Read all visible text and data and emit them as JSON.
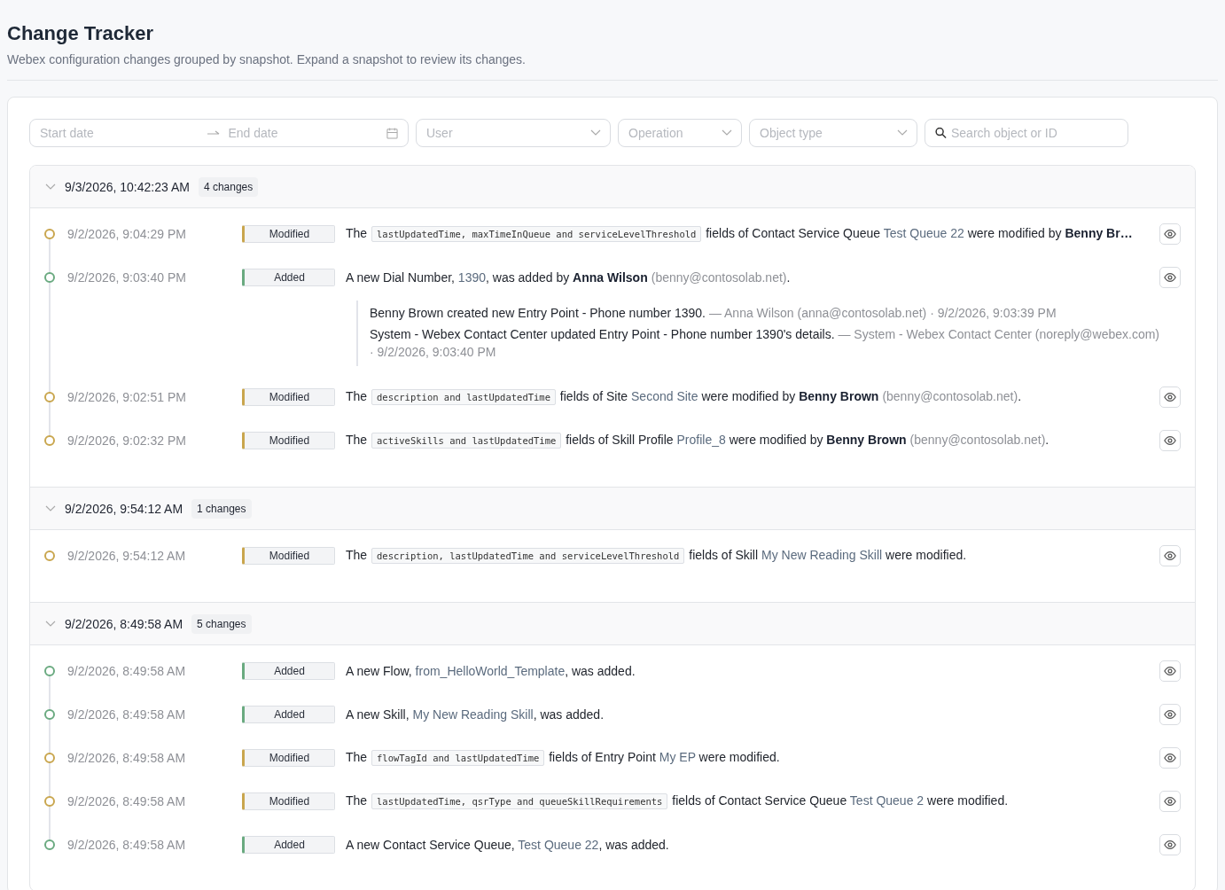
{
  "header": {
    "title": "Change Tracker",
    "subtitle": "Webex configuration changes grouped by snapshot. Expand a snapshot to review its changes."
  },
  "filters": {
    "start_date": {
      "placeholder": "Start date"
    },
    "end_date": {
      "placeholder": "End date"
    },
    "selects": [
      {
        "placeholder": "User"
      },
      {
        "placeholder": "Operation"
      },
      {
        "placeholder": "Object type"
      }
    ],
    "search": {
      "placeholder": "Search object or ID"
    }
  },
  "snapshots": [
    {
      "time": "9/3/2026, 10:42:23 AM",
      "count": "4 changes",
      "expanded": true,
      "changes": [
        {
          "time": "9/2/2026, 9:04:29 PM",
          "kind": "modified",
          "operation": "Modified",
          "description": [
            {
              "kind": "text",
              "text": "The "
            },
            {
              "kind": "code",
              "text": "lastUpdatedTime, maxTimeInQueue and serviceLevelThreshold"
            },
            {
              "kind": "text",
              "text": " fields of Contact Service Queue "
            },
            {
              "kind": "name",
              "text": "Test Queue 22"
            },
            {
              "kind": "text",
              "text": " were modified by "
            },
            {
              "kind": "user",
              "text": "Benny Br…"
            }
          ]
        },
        {
          "time": "9/2/2026, 9:03:40 PM",
          "kind": "added",
          "operation": "Added",
          "description": [
            {
              "kind": "text",
              "text": "A new Dial Number, "
            },
            {
              "kind": "name",
              "text": "1390"
            },
            {
              "kind": "text",
              "text": ", was added by "
            },
            {
              "kind": "user",
              "text": "Anna Wilson"
            },
            {
              "kind": "email",
              "text": "(benny@contosolab.net)"
            },
            {
              "kind": "text",
              "text": "."
            }
          ],
          "notes": [
            {
              "text": "Benny Brown created new Entry Point - Phone number 1390.",
              "source": "— Anna Wilson (anna@contosolab.net) · 9/2/2026, 9:03:39 PM"
            },
            {
              "text": "System - Webex Contact Center updated Entry Point - Phone number 1390's details.",
              "source": "— System - Webex Contact Center (noreply@webex.com) · 9/2/2026, 9:03:40 PM"
            }
          ]
        },
        {
          "time": "9/2/2026, 9:02:51 PM",
          "kind": "modified",
          "operation": "Modified",
          "description": [
            {
              "kind": "text",
              "text": "The "
            },
            {
              "kind": "code",
              "text": "description and lastUpdatedTime"
            },
            {
              "kind": "text",
              "text": " fields of Site "
            },
            {
              "kind": "name",
              "text": "Second Site"
            },
            {
              "kind": "text",
              "text": " were modified by "
            },
            {
              "kind": "user",
              "text": "Benny Brown"
            },
            {
              "kind": "email",
              "text": "(benny@contosolab.net)"
            },
            {
              "kind": "text",
              "text": "."
            }
          ]
        },
        {
          "time": "9/2/2026, 9:02:32 PM",
          "kind": "modified",
          "operation": "Modified",
          "description": [
            {
              "kind": "text",
              "text": "The "
            },
            {
              "kind": "code",
              "text": "activeSkills and lastUpdatedTime"
            },
            {
              "kind": "text",
              "text": " fields of Skill Profile "
            },
            {
              "kind": "name",
              "text": "Profile_8"
            },
            {
              "kind": "text",
              "text": " were modified by "
            },
            {
              "kind": "user",
              "text": "Benny Brown"
            },
            {
              "kind": "email",
              "text": "(benny@contosolab.net)"
            },
            {
              "kind": "text",
              "text": "."
            }
          ]
        }
      ]
    },
    {
      "time": "9/2/2026, 9:54:12 AM",
      "count": "1 changes",
      "expanded": true,
      "changes": [
        {
          "time": "9/2/2026, 9:54:12 AM",
          "kind": "modified",
          "operation": "Modified",
          "description": [
            {
              "kind": "text",
              "text": "The "
            },
            {
              "kind": "code",
              "text": "description, lastUpdatedTime and serviceLevelThreshold"
            },
            {
              "kind": "text",
              "text": " fields of Skill "
            },
            {
              "kind": "name",
              "text": "My New Reading Skill"
            },
            {
              "kind": "text",
              "text": " were modified."
            }
          ]
        }
      ]
    },
    {
      "time": "9/2/2026, 8:49:58 AM",
      "count": "5 changes",
      "expanded": true,
      "changes": [
        {
          "time": "9/2/2026, 8:49:58 AM",
          "kind": "added",
          "operation": "Added",
          "description": [
            {
              "kind": "text",
              "text": "A new Flow, "
            },
            {
              "kind": "name",
              "text": "from_HelloWorld_Template"
            },
            {
              "kind": "text",
              "text": ", was added."
            }
          ]
        },
        {
          "time": "9/2/2026, 8:49:58 AM",
          "kind": "added",
          "operation": "Added",
          "description": [
            {
              "kind": "text",
              "text": "A new Skill, "
            },
            {
              "kind": "name",
              "text": "My New Reading Skill"
            },
            {
              "kind": "text",
              "text": ", was added."
            }
          ]
        },
        {
          "time": "9/2/2026, 8:49:58 AM",
          "kind": "modified",
          "operation": "Modified",
          "description": [
            {
              "kind": "text",
              "text": "The "
            },
            {
              "kind": "code",
              "text": "flowTagId and lastUpdatedTime"
            },
            {
              "kind": "text",
              "text": " fields of Entry Point "
            },
            {
              "kind": "name",
              "text": "My EP"
            },
            {
              "kind": "text",
              "text": " were modified."
            }
          ]
        },
        {
          "time": "9/2/2026, 8:49:58 AM",
          "kind": "modified",
          "operation": "Modified",
          "description": [
            {
              "kind": "text",
              "text": "The "
            },
            {
              "kind": "code",
              "text": "lastUpdatedTime, qsrType and queueSkillRequirements"
            },
            {
              "kind": "text",
              "text": " fields of Contact Service Queue "
            },
            {
              "kind": "name",
              "text": "Test Queue 2"
            },
            {
              "kind": "text",
              "text": " were modified."
            }
          ]
        },
        {
          "time": "9/2/2026, 8:49:58 AM",
          "kind": "added",
          "operation": "Added",
          "description": [
            {
              "kind": "text",
              "text": "A new Contact Service Queue, "
            },
            {
              "kind": "name",
              "text": "Test Queue 22"
            },
            {
              "kind": "text",
              "text": ", was added."
            }
          ]
        }
      ]
    }
  ]
}
